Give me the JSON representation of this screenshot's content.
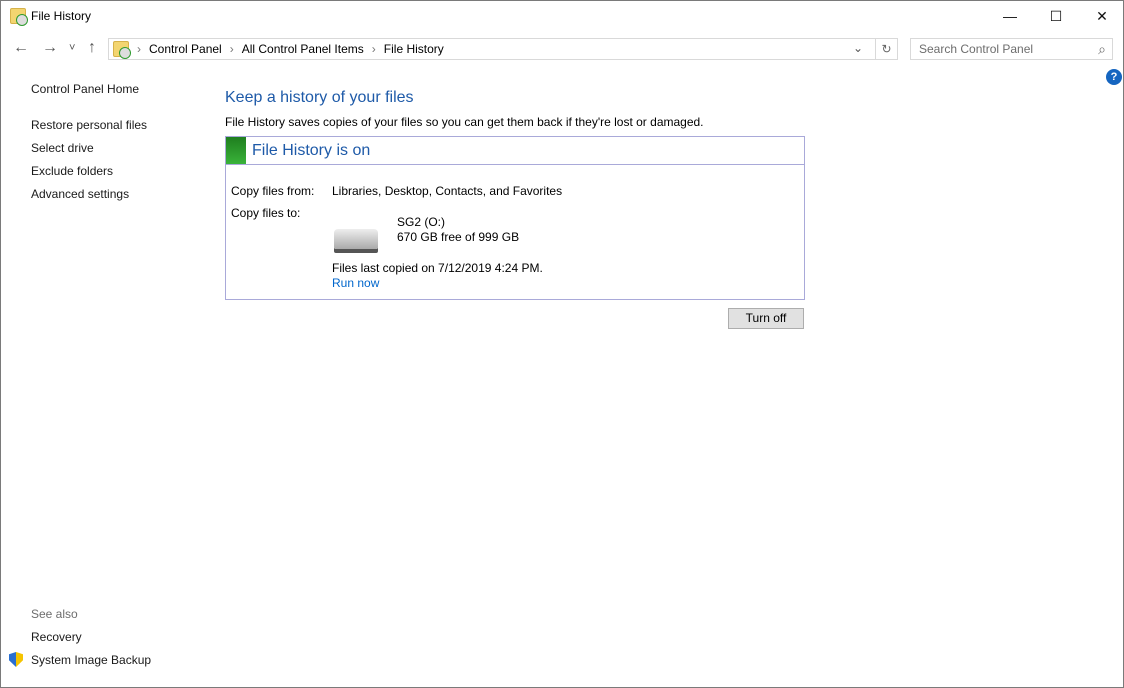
{
  "window": {
    "title": "File History",
    "minimize": "—",
    "maximize": "☐",
    "close": "✕"
  },
  "nav": {
    "back": "←",
    "forward": "→",
    "recent": "˅",
    "up": "↑",
    "refresh": "↻",
    "dropdown": "⌄"
  },
  "breadcrumb": [
    "Control Panel",
    "All Control Panel Items",
    "File History"
  ],
  "search": {
    "placeholder": "Search Control Panel",
    "icon": "⌕"
  },
  "help": "?",
  "sidebar": {
    "items": [
      "Control Panel Home",
      "Restore personal files",
      "Select drive",
      "Exclude folders",
      "Advanced settings"
    ],
    "see_also": "See also",
    "links": [
      "Recovery",
      "System Image Backup"
    ]
  },
  "main": {
    "heading": "Keep a history of your files",
    "description": "File History saves copies of your files so you can get them back if they're lost or damaged.",
    "status": "File History is on",
    "from_label": "Copy files from:",
    "from_value": "Libraries, Desktop, Contacts, and Favorites",
    "to_label": "Copy files to:",
    "drive_name": "SG2 (O:)",
    "drive_space": "670 GB free of 999 GB",
    "last_copied": "Files last copied on 7/12/2019 4:24 PM.",
    "run_now": "Run now",
    "turn_off": "Turn off"
  }
}
